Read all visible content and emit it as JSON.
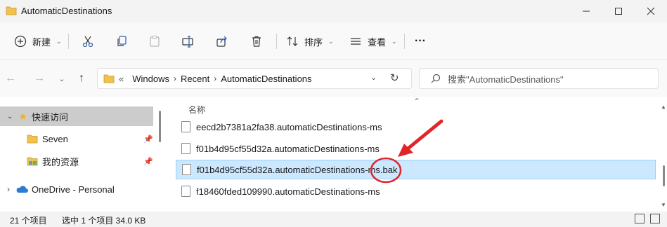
{
  "window": {
    "title": "AutomaticDestinations"
  },
  "toolbar": {
    "new_label": "新建",
    "sort_label": "排序",
    "view_label": "查看",
    "more_label": "···"
  },
  "navigation": {
    "breadcrumbs": [
      "«",
      "Windows",
      "Recent",
      "AutomaticDestinations"
    ],
    "search_placeholder": "搜索\"AutomaticDestinations\""
  },
  "sidebar": {
    "items": [
      {
        "label": "快速访问"
      },
      {
        "label": "Seven"
      },
      {
        "label": "我的资源"
      },
      {
        "label": "OneDrive - Personal"
      }
    ]
  },
  "content": {
    "column_name": "名称",
    "files": [
      {
        "name": "eecd2b7381a2fa38.automaticDestinations-ms"
      },
      {
        "name": "f01b4d95cf55d32a.automaticDestinations-ms"
      },
      {
        "name": "f01b4d95cf55d32a.automaticDestinations-ms.bak"
      },
      {
        "name": "f18460fded109990.automaticDestinations-ms"
      }
    ]
  },
  "status": {
    "count": "21 个项目",
    "selection": "选中 1 个项目  34.0 KB"
  },
  "colors": {
    "selection_bg": "#cce8ff",
    "annotation_red": "#e0262a",
    "folder_yellow": "#f2c14e",
    "onedrive_blue": "#2b7cd3"
  }
}
